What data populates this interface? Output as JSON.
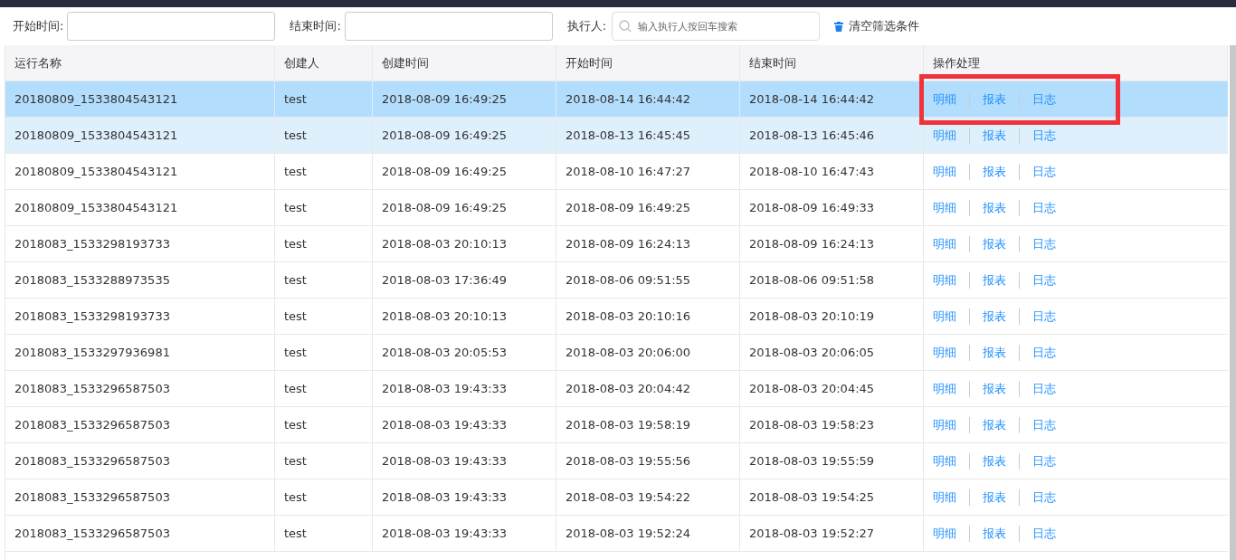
{
  "filters": {
    "start_label": "开始时间:",
    "end_label": "结束时间:",
    "executor_label": "执行人:",
    "executor_placeholder": "输入执行人按回车搜索",
    "clear_button": "清空筛选条件"
  },
  "table": {
    "columns": [
      "运行名称",
      "创建人",
      "创建时间",
      "开始时间",
      "结束时间",
      "操作处理"
    ],
    "rows": [
      {
        "cells": [
          "20180809_1533804543121",
          "test",
          "2018-08-09 16:49:25",
          "2018-08-14 16:44:42",
          "2018-08-14 16:44:42"
        ],
        "actions": [
          "明细",
          "报表",
          "日志"
        ],
        "selected": true,
        "hovered": false
      },
      {
        "cells": [
          "20180809_1533804543121",
          "test",
          "2018-08-09 16:49:25",
          "2018-08-13 16:45:45",
          "2018-08-13 16:45:46"
        ],
        "actions": [
          "明细",
          "报表",
          "日志"
        ],
        "selected": false,
        "hovered": true
      },
      {
        "cells": [
          "20180809_1533804543121",
          "test",
          "2018-08-09 16:49:25",
          "2018-08-10 16:47:27",
          "2018-08-10 16:47:43"
        ],
        "actions": [
          "明细",
          "报表",
          "日志"
        ],
        "selected": false,
        "hovered": false
      },
      {
        "cells": [
          "20180809_1533804543121",
          "test",
          "2018-08-09 16:49:25",
          "2018-08-09 16:49:25",
          "2018-08-09 16:49:33"
        ],
        "actions": [
          "明细",
          "报表",
          "日志"
        ],
        "selected": false,
        "hovered": false
      },
      {
        "cells": [
          "2018083_1533298193733",
          "test",
          "2018-08-03 20:10:13",
          "2018-08-09 16:24:13",
          "2018-08-09 16:24:13"
        ],
        "actions": [
          "明细",
          "报表",
          "日志"
        ],
        "selected": false,
        "hovered": false
      },
      {
        "cells": [
          "2018083_1533288973535",
          "test",
          "2018-08-03 17:36:49",
          "2018-08-06 09:51:55",
          "2018-08-06 09:51:58"
        ],
        "actions": [
          "明细",
          "报表",
          "日志"
        ],
        "selected": false,
        "hovered": false
      },
      {
        "cells": [
          "2018083_1533298193733",
          "test",
          "2018-08-03 20:10:13",
          "2018-08-03 20:10:16",
          "2018-08-03 20:10:19"
        ],
        "actions": [
          "明细",
          "报表",
          "日志"
        ],
        "selected": false,
        "hovered": false
      },
      {
        "cells": [
          "2018083_1533297936981",
          "test",
          "2018-08-03 20:05:53",
          "2018-08-03 20:06:00",
          "2018-08-03 20:06:05"
        ],
        "actions": [
          "明细",
          "报表",
          "日志"
        ],
        "selected": false,
        "hovered": false
      },
      {
        "cells": [
          "2018083_1533296587503",
          "test",
          "2018-08-03 19:43:33",
          "2018-08-03 20:04:42",
          "2018-08-03 20:04:45"
        ],
        "actions": [
          "明细",
          "报表",
          "日志"
        ],
        "selected": false,
        "hovered": false
      },
      {
        "cells": [
          "2018083_1533296587503",
          "test",
          "2018-08-03 19:43:33",
          "2018-08-03 19:58:19",
          "2018-08-03 19:58:23"
        ],
        "actions": [
          "明细",
          "报表",
          "日志"
        ],
        "selected": false,
        "hovered": false
      },
      {
        "cells": [
          "2018083_1533296587503",
          "test",
          "2018-08-03 19:43:33",
          "2018-08-03 19:55:56",
          "2018-08-03 19:55:59"
        ],
        "actions": [
          "明细",
          "报表",
          "日志"
        ],
        "selected": false,
        "hovered": false
      },
      {
        "cells": [
          "2018083_1533296587503",
          "test",
          "2018-08-03 19:43:33",
          "2018-08-03 19:54:22",
          "2018-08-03 19:54:25"
        ],
        "actions": [
          "明细",
          "报表",
          "日志"
        ],
        "selected": false,
        "hovered": false
      },
      {
        "cells": [
          "2018083_1533296587503",
          "test",
          "2018-08-03 19:43:33",
          "2018-08-03 19:52:24",
          "2018-08-03 19:52:27"
        ],
        "actions": [
          "明细",
          "报表",
          "日志"
        ],
        "selected": false,
        "hovered": false
      }
    ]
  }
}
